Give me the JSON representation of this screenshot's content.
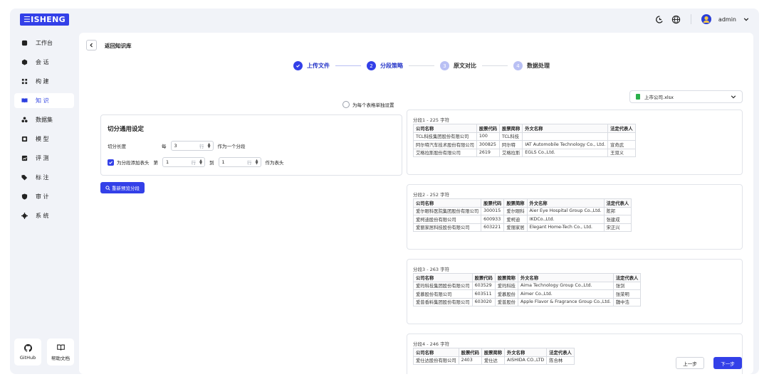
{
  "app": {
    "logo": "ISHENG"
  },
  "topbar": {
    "user": "admin"
  },
  "sidebar": {
    "items": [
      {
        "label": "工作台",
        "icon": "dashboard-icon",
        "active": false
      },
      {
        "label": "会 话",
        "icon": "chat-icon",
        "active": false
      },
      {
        "label": "构 建",
        "icon": "build-icon",
        "active": false
      },
      {
        "label": "知 识",
        "icon": "book-icon",
        "active": true
      },
      {
        "label": "数据集",
        "icon": "dataset-icon",
        "active": false
      },
      {
        "label": "模 型",
        "icon": "model-icon",
        "active": false
      },
      {
        "label": "评 测",
        "icon": "evaluate-icon",
        "active": false
      },
      {
        "label": "标 注",
        "icon": "tag-icon",
        "active": false
      },
      {
        "label": "审 计",
        "icon": "audit-icon",
        "active": false
      },
      {
        "label": "系 统",
        "icon": "settings-icon",
        "active": false
      }
    ],
    "bottom": [
      {
        "label": "GitHub",
        "icon": "github-icon"
      },
      {
        "label": "帮助文档",
        "icon": "help-book-icon"
      }
    ]
  },
  "header": {
    "back_title": "返回知识库"
  },
  "steps": [
    {
      "number": "1",
      "label": "上传文件",
      "state": "done"
    },
    {
      "number": "2",
      "label": "分段策略",
      "state": "current"
    },
    {
      "number": "3",
      "label": "原文对比",
      "state": "todo"
    },
    {
      "number": "4",
      "label": "数据处理",
      "state": "todo"
    }
  ],
  "form": {
    "per_table_label": "为每个表格单独设置",
    "title": "切分通用设定",
    "length_label": "切分长度",
    "every_label": "每",
    "every_value": "3",
    "rows_unit": "行",
    "as_segment_label": "作为一个分段",
    "add_header_label": "为分段添加表头",
    "add_header_checked": true,
    "from_label": "第",
    "from_value": "1",
    "to_label": "到",
    "to_value": "1",
    "as_header_label": "作为表头",
    "repreview_button": "重新预览分段"
  },
  "file": {
    "name": "上市公司.xlsx"
  },
  "segments": [
    {
      "title": "分段1 - 225 字符",
      "headers": [
        "公司名称",
        "股票代码",
        "股票简称",
        "外文名称",
        "法定代表人"
      ],
      "rows": [
        [
          "TCL科技集团股份有限公司",
          "100",
          "TCL科技",
          "",
          ""
        ],
        [
          "阿尔特汽车技术股份有限公司",
          "300825",
          "阿尔特",
          "IAT Automobile Technology Co., Ltd.",
          "宣奇武"
        ],
        [
          "艾格拉斯股份有限公司",
          "2619",
          "艾格拉斯",
          "EGLS Co.,Ltd.",
          "王双义"
        ]
      ]
    },
    {
      "title": "分段2 - 252 字符",
      "headers": [
        "公司名称",
        "股票代码",
        "股票简称",
        "外文名称",
        "法定代表人"
      ],
      "rows": [
        [
          "爱尔眼科医院集团股份有限公司",
          "300015",
          "爱尔眼科",
          "Aier Eye Hospital Group Co.,Ltd.",
          "陈邦"
        ],
        [
          "爱柯迪股份有限公司",
          "600933",
          "爱柯迪",
          "IKDCo.,Ltd.",
          "张建成"
        ],
        [
          "爱丽家居科技股份有限公司",
          "603221",
          "爱丽家居",
          "Elegant Home-Tech Co., Ltd.",
          "宋正兴"
        ]
      ]
    },
    {
      "title": "分段3 - 263 字符",
      "headers": [
        "公司名称",
        "股票代码",
        "股票简称",
        "外文名称",
        "法定代表人"
      ],
      "rows": [
        [
          "爱玛科技集团股份有限公司",
          "603529",
          "爱玛科技",
          "Aima Technology Group Co.,Ltd.",
          "张剑"
        ],
        [
          "爱慕股份有限公司",
          "603511",
          "爱慕股份",
          "Aimer Co.,Ltd.",
          "张荣明"
        ],
        [
          "爱普香料集团股份有限公司",
          "603020",
          "爱普股份",
          "Apple Flavor & Fragrance Group Co.,Ltd.",
          "魏中浩"
        ]
      ]
    },
    {
      "title": "分段4 - 246 字符",
      "headers": [
        "公司名称",
        "股票代码",
        "股票简称",
        "外文名称",
        "法定代表人"
      ],
      "rows": [
        [
          "爱仕达股份有限公司",
          "2403",
          "爱仕达",
          "AISHIDA CO.,LTD",
          "陈合林"
        ]
      ]
    }
  ],
  "footer": {
    "prev": "上一步",
    "next": "下一步"
  },
  "colors": {
    "primary": "#3340e8",
    "active_text": "#2c3fe0",
    "background": "#f1f3f8"
  }
}
